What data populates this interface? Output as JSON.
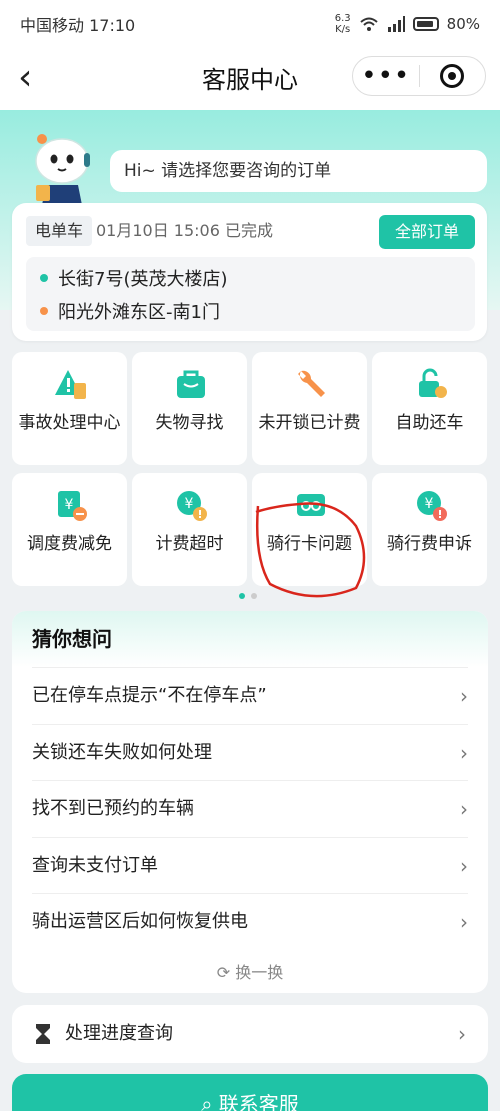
{
  "status": {
    "carrier_time": "中国移动 17:10",
    "speed_value": "6.3",
    "speed_unit": "K/s",
    "battery": "80%"
  },
  "nav": {
    "back": "‹",
    "title": "客服中心",
    "more": "•••"
  },
  "hero": {
    "greeting": "Hi~ 请选择您要咨询的订单"
  },
  "order": {
    "type_tag": "电单车",
    "time_status": "01月10日 15:06  已完成",
    "all_orders_label": "全部订单",
    "start": "长街7号(英茂大楼店)",
    "end": "阳光外滩东区-南1门",
    "start_color": "#1fc3a6",
    "end_color": "#f7924a"
  },
  "services": [
    {
      "label": "事故处理中心",
      "icon": "accident-icon"
    },
    {
      "label": "失物寻找",
      "icon": "bag-icon"
    },
    {
      "label": "未开锁已计费",
      "icon": "wrench-icon"
    },
    {
      "label": "自助还车",
      "icon": "lock-icon"
    },
    {
      "label": "调度费减免",
      "icon": "fee-reduce-icon"
    },
    {
      "label": "计费超时",
      "icon": "fee-timeout-icon"
    },
    {
      "label": "骑行卡问题",
      "icon": "ride-card-icon"
    },
    {
      "label": "骑行费申诉",
      "icon": "fee-appeal-icon"
    }
  ],
  "faq": {
    "title": "猜你想问",
    "items": [
      "已在停车点提示“不在停车点”",
      "关锁还车失败如何处理",
      "找不到已预约的车辆",
      "查询未支付订单",
      "骑出运营区后如何恢复供电"
    ],
    "refresh_label": "换一换"
  },
  "progress": {
    "label": "处理进度查询"
  },
  "contact": {
    "label": "联系客服"
  },
  "colors": {
    "accent": "#1fc3a6",
    "icon_orange": "#f7924a"
  }
}
